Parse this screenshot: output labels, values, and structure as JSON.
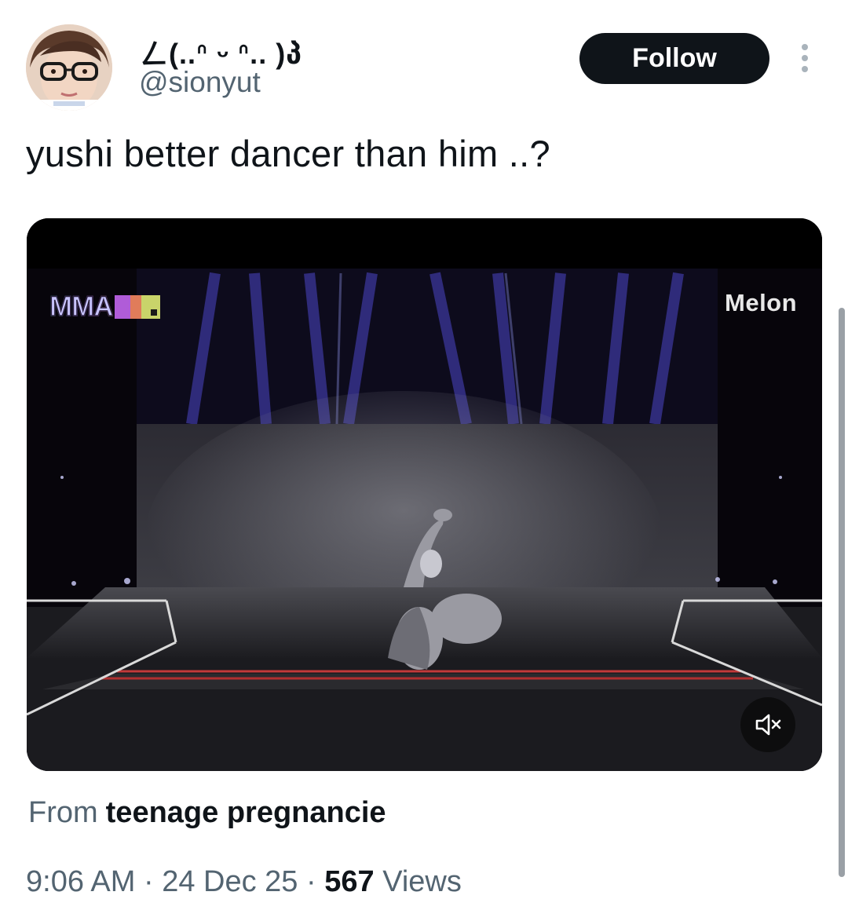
{
  "tweet": {
    "display_name": "ㄥ(..ᐢ ᵕ ᐢ.. )პ",
    "handle": "@sionyut",
    "follow_label": "Follow",
    "text": "yushi better dancer than him ..?",
    "media": {
      "overlay_left_logo": "MMA",
      "overlay_right_logo": "Melon",
      "mute_icon": "speaker-muted-icon"
    },
    "source_prefix": "From",
    "source_name": "teenage pregnancie",
    "time": "9:06 AM",
    "date": "24 Dec 25",
    "separator": "·",
    "views_count": "567",
    "views_label": "Views"
  },
  "colors": {
    "text_primary": "#0f1419",
    "text_secondary": "#536471",
    "button_bg": "#0f1419"
  }
}
